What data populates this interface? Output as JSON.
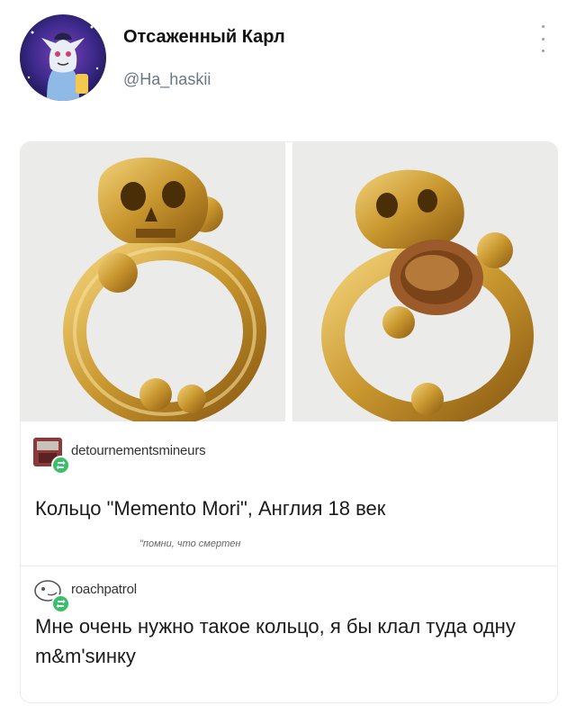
{
  "tweet": {
    "display_name": "Отсаженный Карл",
    "handle": "@Ha_haskii"
  },
  "card": {
    "posts": [
      {
        "blog_name": "detournementsmineurs",
        "text": "Кольцо \"Memento Mori\", Англия 18 век",
        "subtext": "\"помни, что смертен"
      },
      {
        "blog_name": "roachpatrol",
        "text": "Мне очень нужно такое кольцо, я бы клал туда одну m&m'sинку"
      }
    ]
  },
  "colors": {
    "handle": "#6b7784",
    "reblog_green": "#39c06b",
    "gold": "#c8962e"
  }
}
